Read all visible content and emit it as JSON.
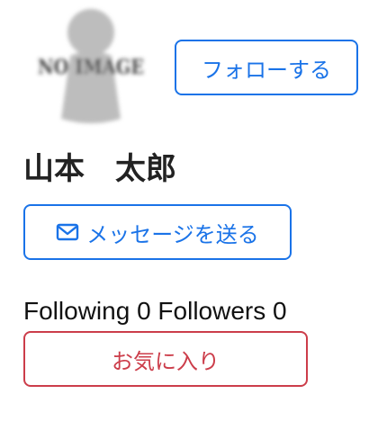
{
  "profile": {
    "avatar_icon": "no-image-placeholder-icon",
    "avatar_text": "NO IMAGE",
    "name": "山本　太郎"
  },
  "actions": {
    "follow_label": "フォローする",
    "message_icon": "envelope-icon",
    "message_label": "メッセージを送る",
    "favorite_label": "お気に入り"
  },
  "stats": {
    "following_label": "Following",
    "following_count": "0",
    "followers_label": "Followers",
    "followers_count": "0"
  },
  "colors": {
    "primary": "#1a73e8",
    "danger": "#cc3d4a",
    "text": "#222222",
    "placeholder": "#b5b5b5"
  }
}
